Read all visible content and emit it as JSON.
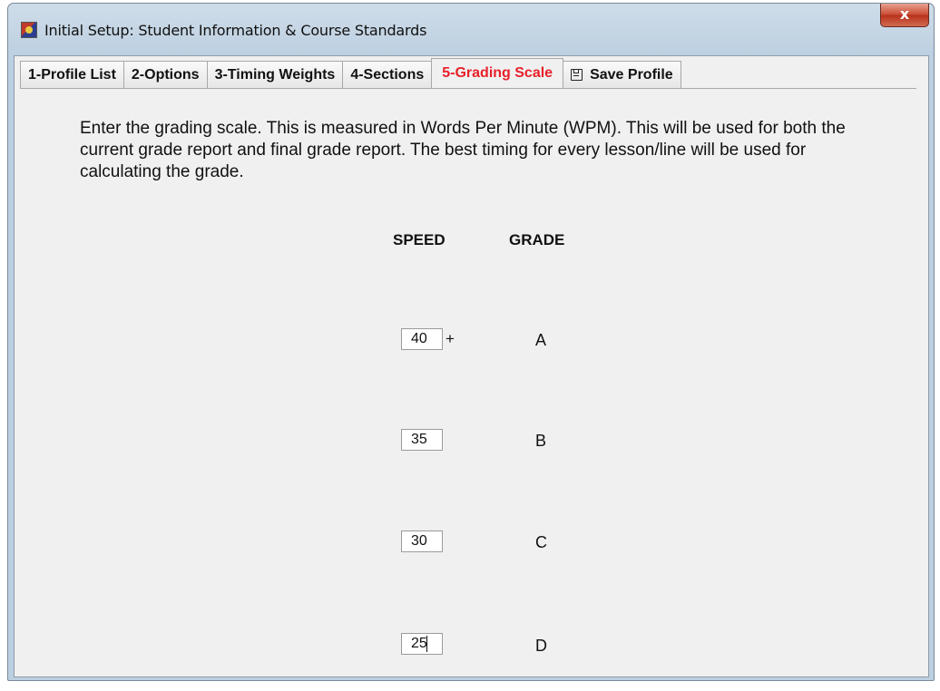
{
  "window": {
    "title": "Initial Setup: Student Information & Course Standards",
    "close_label": "x"
  },
  "tabs": [
    {
      "label": "1-Profile List"
    },
    {
      "label": "2-Options"
    },
    {
      "label": "3-Timing Weights"
    },
    {
      "label": "4-Sections"
    },
    {
      "label": "5-Grading Scale"
    },
    {
      "label": "Save Profile",
      "icon": "save-icon"
    }
  ],
  "active_tab": "5-Grading Scale",
  "colors": {
    "active_tab_text": "#e8202a",
    "close_button": "#c84a32"
  },
  "content": {
    "description": "Enter the grading scale. This is measured in Words Per Minute (WPM). This will be used for both the current grade report and final grade report. The best timing for every lesson/line will be used for calculating the grade.",
    "speed_header": "SPEED",
    "grade_header": "GRADE",
    "rows": [
      {
        "speed": "40",
        "suffix": "+",
        "grade": "A"
      },
      {
        "speed": "35",
        "suffix": "",
        "grade": "B"
      },
      {
        "speed": "30",
        "suffix": "",
        "grade": "C"
      },
      {
        "speed": "25",
        "suffix": "",
        "grade": "D"
      }
    ]
  }
}
